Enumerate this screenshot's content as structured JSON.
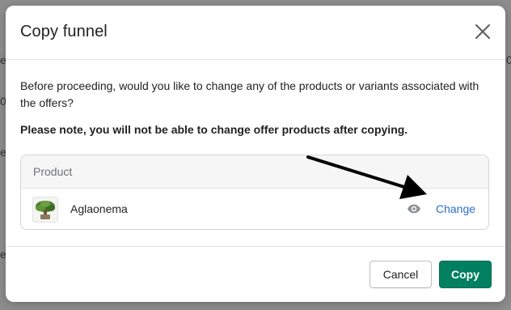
{
  "background": {
    "fragments": [
      "e",
      "0",
      "0",
      "e",
      "e"
    ]
  },
  "modal": {
    "title": "Copy funnel",
    "close_icon": "close-icon",
    "intro": "Before proceeding, would you like to change any of the products or variants associated with the offers?",
    "note": "Please note, you will not be able to change offer products after copying.",
    "products": {
      "header": "Product",
      "items": [
        {
          "name": "Aglaonema",
          "thumbnail_icon": "plant-thumbnail",
          "preview_icon": "eye-icon",
          "action_label": "Change"
        }
      ]
    },
    "footer": {
      "cancel_label": "Cancel",
      "copy_label": "Copy"
    }
  },
  "annotation": {
    "arrow_icon": "arrow-icon"
  },
  "colors": {
    "primary": "#008060",
    "link": "#2c6ecb",
    "backdrop": "#8e8e8e"
  }
}
